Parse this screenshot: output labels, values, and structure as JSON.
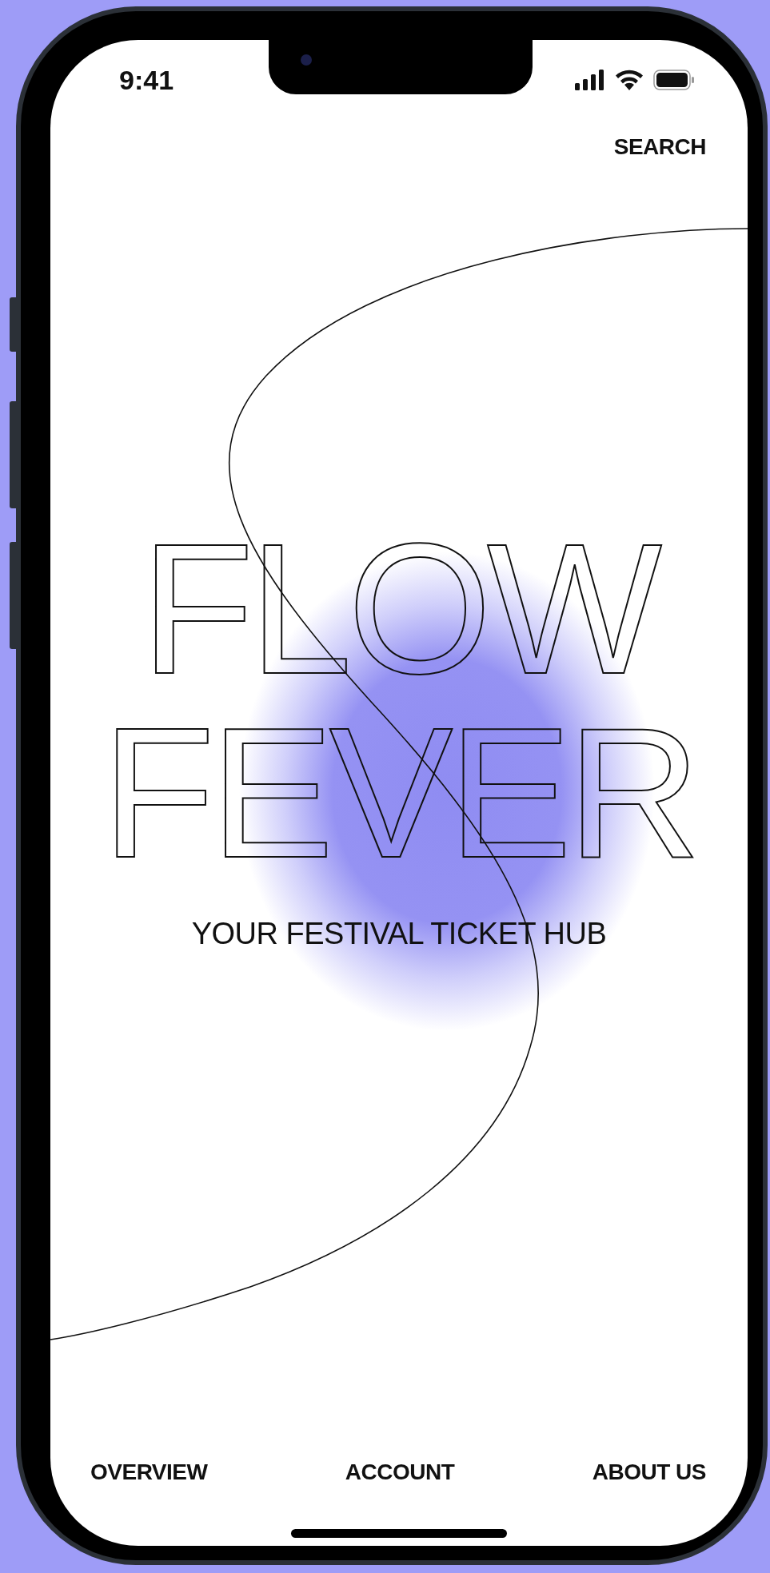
{
  "status_bar": {
    "time": "9:41"
  },
  "header": {
    "search": "SEARCH"
  },
  "hero": {
    "title_lines": [
      "FLOW",
      "FEVER"
    ],
    "subtitle": "YOUR FESTIVAL TICKET HUB"
  },
  "nav": [
    {
      "label": "OVERVIEW"
    },
    {
      "label": "ACCOUNT"
    },
    {
      "label": "ABOUT US"
    }
  ]
}
